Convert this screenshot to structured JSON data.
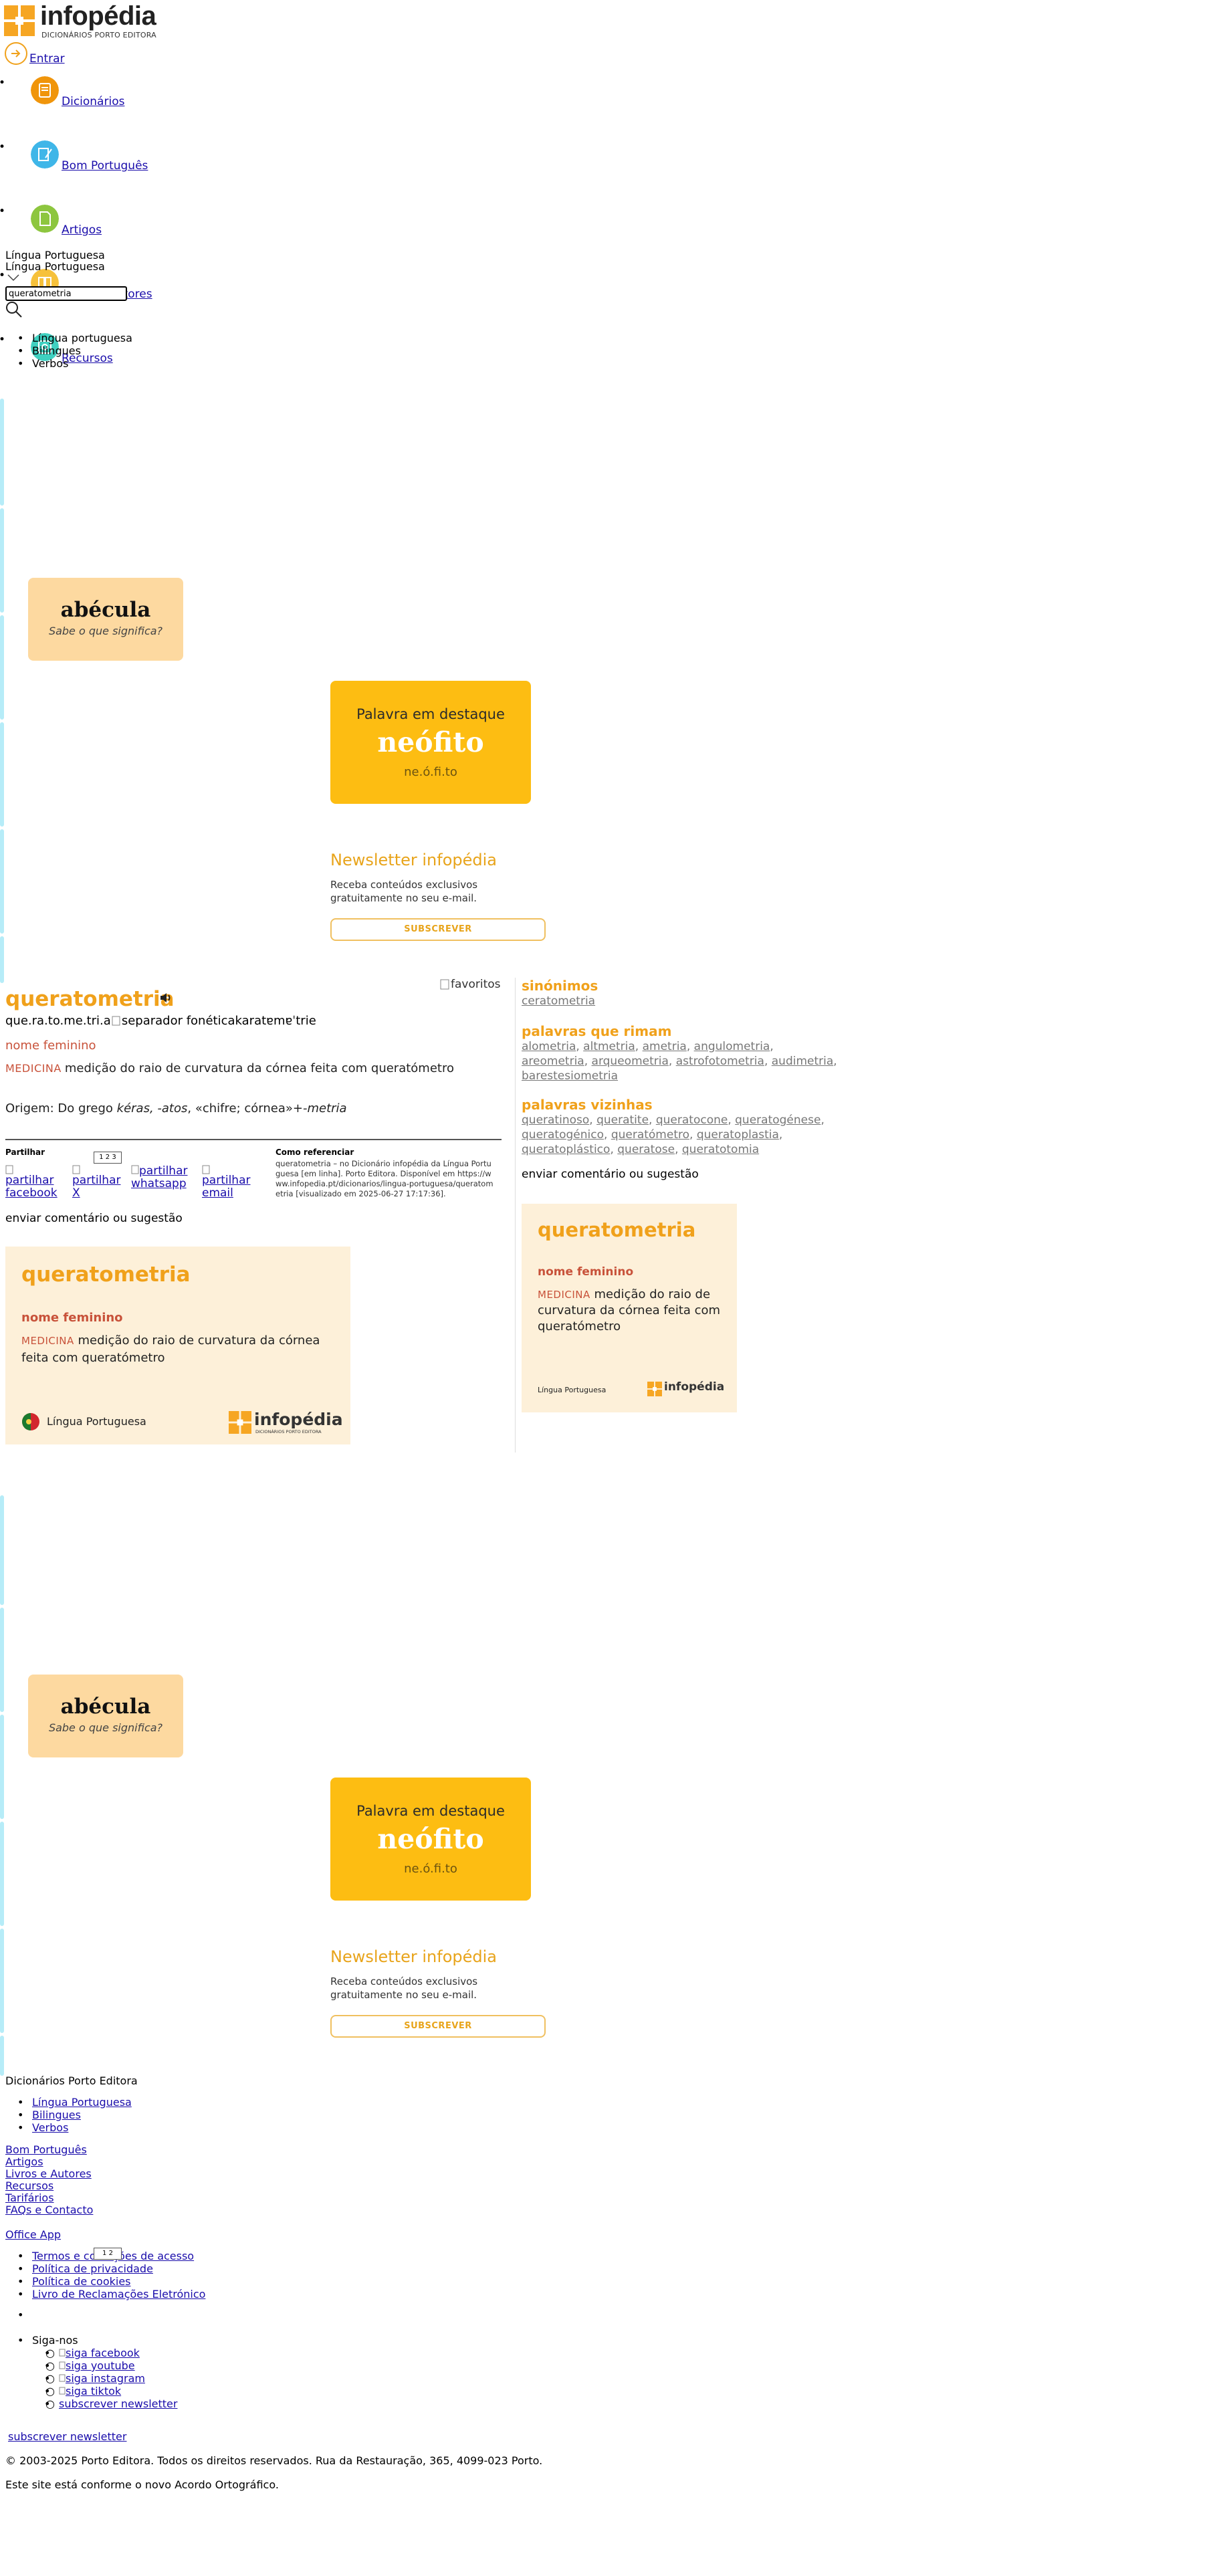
{
  "header": {
    "logo_text": "infopédia",
    "logo_sub": "DICIONÁRIOS PORTO EDITORA",
    "login_label": "Entrar",
    "colors": {
      "brand_orange": "#f0a11b"
    }
  },
  "nav": [
    {
      "label": "Dicionários",
      "icon": "book-icon",
      "color": "#f0950b"
    },
    {
      "label": "Bom Português",
      "icon": "pen-icon",
      "color": "#3fb6e8"
    },
    {
      "label": "Artigos",
      "icon": "document-icon",
      "color": "#8dc63f"
    },
    {
      "label": "Livros e autores",
      "icon": "books-icon",
      "color": "#f6c13b"
    },
    {
      "label": "Recursos",
      "icon": "tools-icon",
      "color": "#3fd0c0"
    }
  ],
  "search": {
    "dictionary_label": "Língua Portuguesa",
    "dictionary_selected": "Língua Portuguesa",
    "query": "queratometria",
    "options": [
      "Língua portuguesa",
      "Bilingues",
      "Verbos"
    ]
  },
  "promo": {
    "abecula_word": "abécula",
    "abecula_sub": "Sabe o que significa?",
    "featured_title": "Palavra em destaque",
    "featured_word": "neófito",
    "featured_syll": "ne.ó.fi.to",
    "newsletter_title": "Newsletter infopédia",
    "newsletter_text1": "Receba conteúdos exclusivos",
    "newsletter_text2": "gratuitamente no seu e-mail.",
    "newsletter_btn": "SUBSCREVER"
  },
  "entry": {
    "favorites_alt": "favoritos",
    "headword": "queratometria",
    "syll_prefix": "que.ra.to.me.tri.a",
    "syll_sep_alt": "separador fonética",
    "phonetic": "karatɐmɐˈtrie",
    "pos": "nome feminino",
    "domain": "MEDICINA",
    "definition": "medição do raio de curvatura da córnea feita com queratómetro",
    "origin_prefix": "Origem: Do grego ",
    "origin_greek": "kéras, -atos",
    "origin_mid": ", «chifre; córnea»+",
    "origin_suffix": "-metria",
    "share_label": "Partilhar",
    "share_facebook": "partilhar facebook",
    "share_x": "partilhar X",
    "share_whatsapp": "partilhar whatsapp",
    "share_email": "partilhar email",
    "cite_label": "Como referenciar",
    "cite_text": "queratometria – no Dicionário infopédia da Língua Portuguesa [em linha]. Porto Editora. Disponível em https://www.infopedia.pt/dicionarios/lingua-portuguesa/queratometria [visualizado em 2025-06-27 17:17:36].",
    "feedback": "enviar comentário ou sugestão",
    "card_lang": "Língua Portuguesa",
    "card_logo": "infopédia",
    "card_logo_sub": "DICIONÁRIOS PORTO EDITORA"
  },
  "side": {
    "synonyms_title": "sinónimos",
    "synonyms": [
      "ceratometria"
    ],
    "rhymes_title": "palavras que rimam",
    "rhymes_line1": [
      "alometria",
      "altmetria",
      "ametria",
      "angulometria"
    ],
    "rhymes_line2": [
      "areometria",
      "arqueometria",
      "astrofotometria",
      "audimetria"
    ],
    "rhymes_line3": [
      "barestesiometria"
    ],
    "neighbors_title": "palavras vizinhas",
    "neighbors_line1": [
      "queratinoso",
      "queratite",
      "queratocone",
      "queratogénese"
    ],
    "neighbors_line2": [
      "queratogénico",
      "queratómetro",
      "queratoplastia"
    ],
    "neighbors_line3": [
      "queratoplástico",
      "queratose",
      "queratotomia"
    ],
    "feedback": "enviar comentário ou sugestão",
    "card_lang": "Língua Portuguesa"
  },
  "footer": {
    "brand": "Dicionários Porto Editora",
    "dict_links": [
      "Língua Portuguesa",
      "Bilingues",
      "Verbos"
    ],
    "links": [
      "Bom Português",
      "Artigos",
      "Livros e Autores",
      "Recursos",
      "Tarifários",
      "FAQs e Contacto"
    ],
    "office": "Office App",
    "legal": [
      "Termos e condições de acesso",
      "Política de privacidade",
      "Política de cookies",
      "Livro de Reclamações Eletrónico"
    ],
    "follow": "Siga-nos",
    "social": [
      "siga facebook",
      "siga youtube",
      "siga instagram",
      "siga tiktok",
      "subscrever newsletter"
    ],
    "subscribe": "subscrever newsletter",
    "copyright": "© 2003-2025 Porto Editora. Todos os direitos reservados. Rua da Restauração, 365, 4099-023 Porto.",
    "ortho": "Este site está conforme o novo Acordo Ortográfico."
  }
}
